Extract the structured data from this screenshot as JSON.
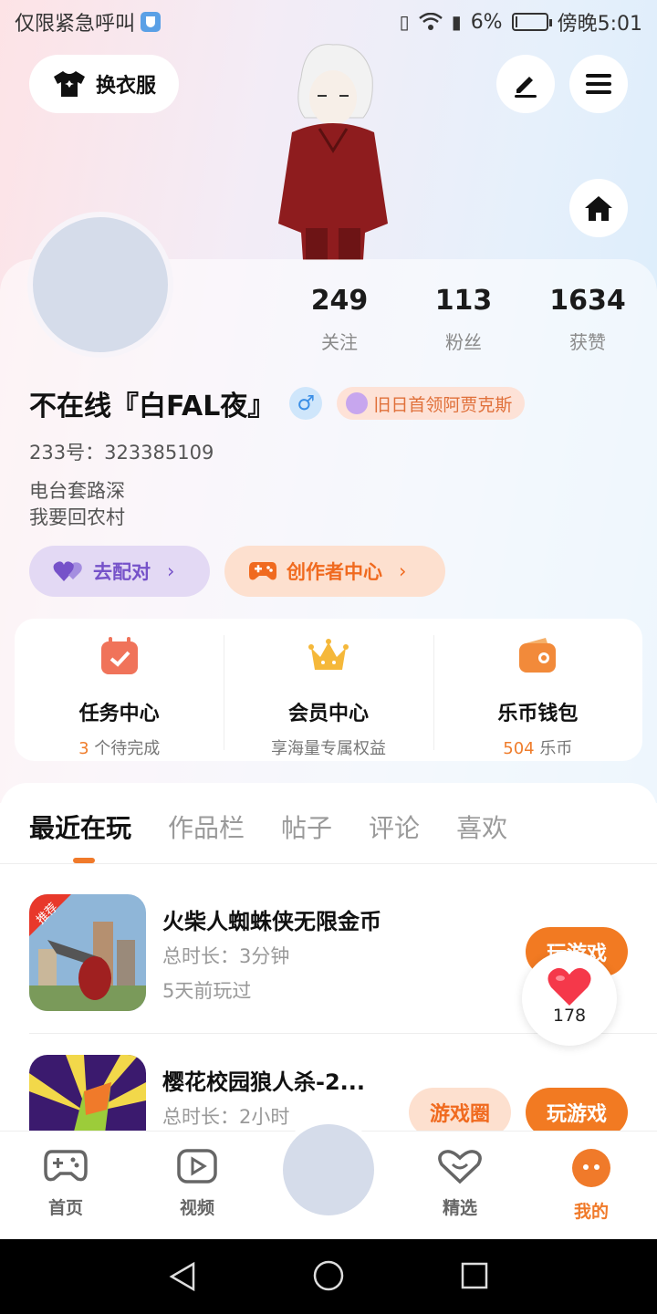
{
  "status_bar": {
    "left_text": "仅限紧急呼叫",
    "battery_text": "6%",
    "time": "傍晚5:01",
    "battery_level": 0.06
  },
  "header": {
    "outfit_button": "换衣服",
    "icons": [
      "shirt-icon",
      "edit-icon",
      "menu-icon",
      "home-icon"
    ]
  },
  "profile": {
    "stats": [
      {
        "value": "249",
        "label": "关注"
      },
      {
        "value": "113",
        "label": "粉丝"
      },
      {
        "value": "1634",
        "label": "获赞"
      }
    ],
    "name": "不在线『白FAL夜』",
    "gender_symbol": "♂",
    "title_badge": "旧日首领阿贾克斯",
    "uid": "233号：323385109",
    "bio_lines": [
      "电台套路深",
      "我要回农村"
    ],
    "match_button": "去配对",
    "creator_button": "创作者中心"
  },
  "entries": [
    {
      "title": "任务中心",
      "count": "3",
      "subtitle": " 个待完成"
    },
    {
      "title": "会员中心",
      "subtitle": "享海量专属权益"
    },
    {
      "title": "乐币钱包",
      "count": "504",
      "subtitle": " 乐币"
    }
  ],
  "tabs": [
    "最近在玩",
    "作品栏",
    "帖子",
    "评论",
    "喜欢"
  ],
  "games": [
    {
      "name": "火柴人蜘蛛侠无限金币",
      "duration": "总时长：3分钟",
      "last_played": "5天前玩过",
      "badge": "推荐",
      "play_button": "玩游戏"
    },
    {
      "name": "樱花校园狼人杀-2...",
      "duration": "总时长：2小时",
      "circle_button": "游戏圈",
      "play_button": "玩游戏"
    }
  ],
  "like_bubble": {
    "count": "178"
  },
  "bottom_nav": [
    {
      "label": "首页",
      "icon": "gamepad-icon"
    },
    {
      "label": "视频",
      "icon": "video-icon"
    },
    {
      "label": "精选",
      "icon": "featured-heart-icon"
    },
    {
      "label": "我的",
      "icon": "profile-face-icon"
    }
  ],
  "colors": {
    "accent": "#f27a22",
    "purple": "#7652c9",
    "gender_blue": "#3a8ee6"
  }
}
